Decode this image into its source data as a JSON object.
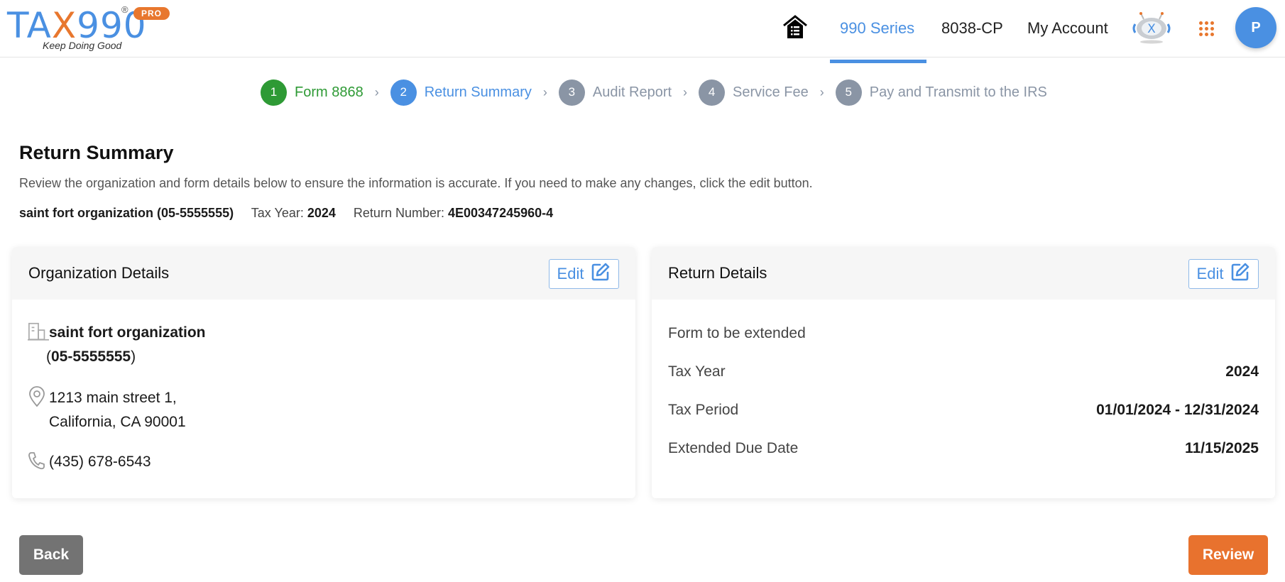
{
  "logo": {
    "text_left": "TA",
    "text_x": "X",
    "text_right": "990",
    "registered": "®",
    "badge": "PRO",
    "tagline": "Keep Doing Good"
  },
  "nav": {
    "home_icon": "home-list-icon",
    "links": [
      {
        "label": "990 Series",
        "active": true
      },
      {
        "label": "8038-CP",
        "active": false
      },
      {
        "label": "My Account",
        "active": false
      }
    ],
    "bot_icon": "tax-bot-icon",
    "apps_icon": "apps-grid-icon",
    "avatar_initial": "P",
    "accent": "#4a90e2"
  },
  "stepper": {
    "steps": [
      {
        "num": "1",
        "label": "Form 8868",
        "state": "done"
      },
      {
        "num": "2",
        "label": "Return Summary",
        "state": "active"
      },
      {
        "num": "3",
        "label": "Audit Report",
        "state": "todo"
      },
      {
        "num": "4",
        "label": "Service Fee",
        "state": "todo"
      },
      {
        "num": "5",
        "label": "Pay and Transmit to the IRS",
        "state": "todo"
      }
    ],
    "separator": "›",
    "colors": {
      "done": "#2e9a35",
      "active": "#4a90e2",
      "todo": "#8a95a5"
    }
  },
  "page": {
    "title": "Return Summary",
    "description": "Review the organization and form details below to ensure the information is accurate. If you need to make any changes, click the edit button.",
    "org_line": "saint fort organization (05-5555555)",
    "tax_year_label": "Tax Year:",
    "tax_year_value": "2024",
    "return_number_label": "Return Number:",
    "return_number_value": "4E00347245960-4"
  },
  "org_card": {
    "title": "Organization Details",
    "edit_label": "Edit",
    "name": "saint fort organization",
    "ein_open": "(",
    "ein": "05-5555555",
    "ein_close": ")",
    "address_line1": "1213 main street 1,",
    "address_line2": "California, CA 90001",
    "phone": "(435) 678-6543"
  },
  "return_card": {
    "title": "Return Details",
    "edit_label": "Edit",
    "rows": [
      {
        "label": "Form to be extended",
        "value": ""
      },
      {
        "label": "Tax Year",
        "value": "2024"
      },
      {
        "label": "Tax Period",
        "value": "01/01/2024 - 12/31/2024"
      },
      {
        "label": "Extended Due Date",
        "value": "11/15/2025"
      }
    ]
  },
  "actions": {
    "back_label": "Back",
    "review_label": "Review",
    "review_color": "#e8722e",
    "back_color": "#737373"
  }
}
